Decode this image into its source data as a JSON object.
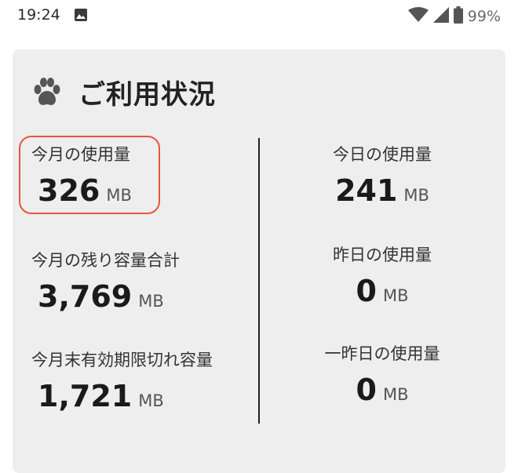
{
  "status_bar": {
    "time": "19:24",
    "battery_percent": "99%"
  },
  "card": {
    "title": "ご利用状況",
    "icon": "paw-icon",
    "left": [
      {
        "label": "今月の使用量",
        "value": "326",
        "unit": "MB",
        "highlighted": true
      },
      {
        "label": "今月の残り容量合計",
        "value": "3,769",
        "unit": "MB"
      },
      {
        "label": "今月末有効期限切れ容量",
        "value": "1,721",
        "unit": "MB"
      }
    ],
    "right": [
      {
        "label": "今日の使用量",
        "value": "241",
        "unit": "MB"
      },
      {
        "label": "昨日の使用量",
        "value": "0",
        "unit": "MB"
      },
      {
        "label": "一昨日の使用量",
        "value": "0",
        "unit": "MB"
      }
    ]
  },
  "colors": {
    "card_background": "#eeeeee",
    "highlight_border": "#e8553b",
    "text_primary": "#1a1a1a"
  }
}
